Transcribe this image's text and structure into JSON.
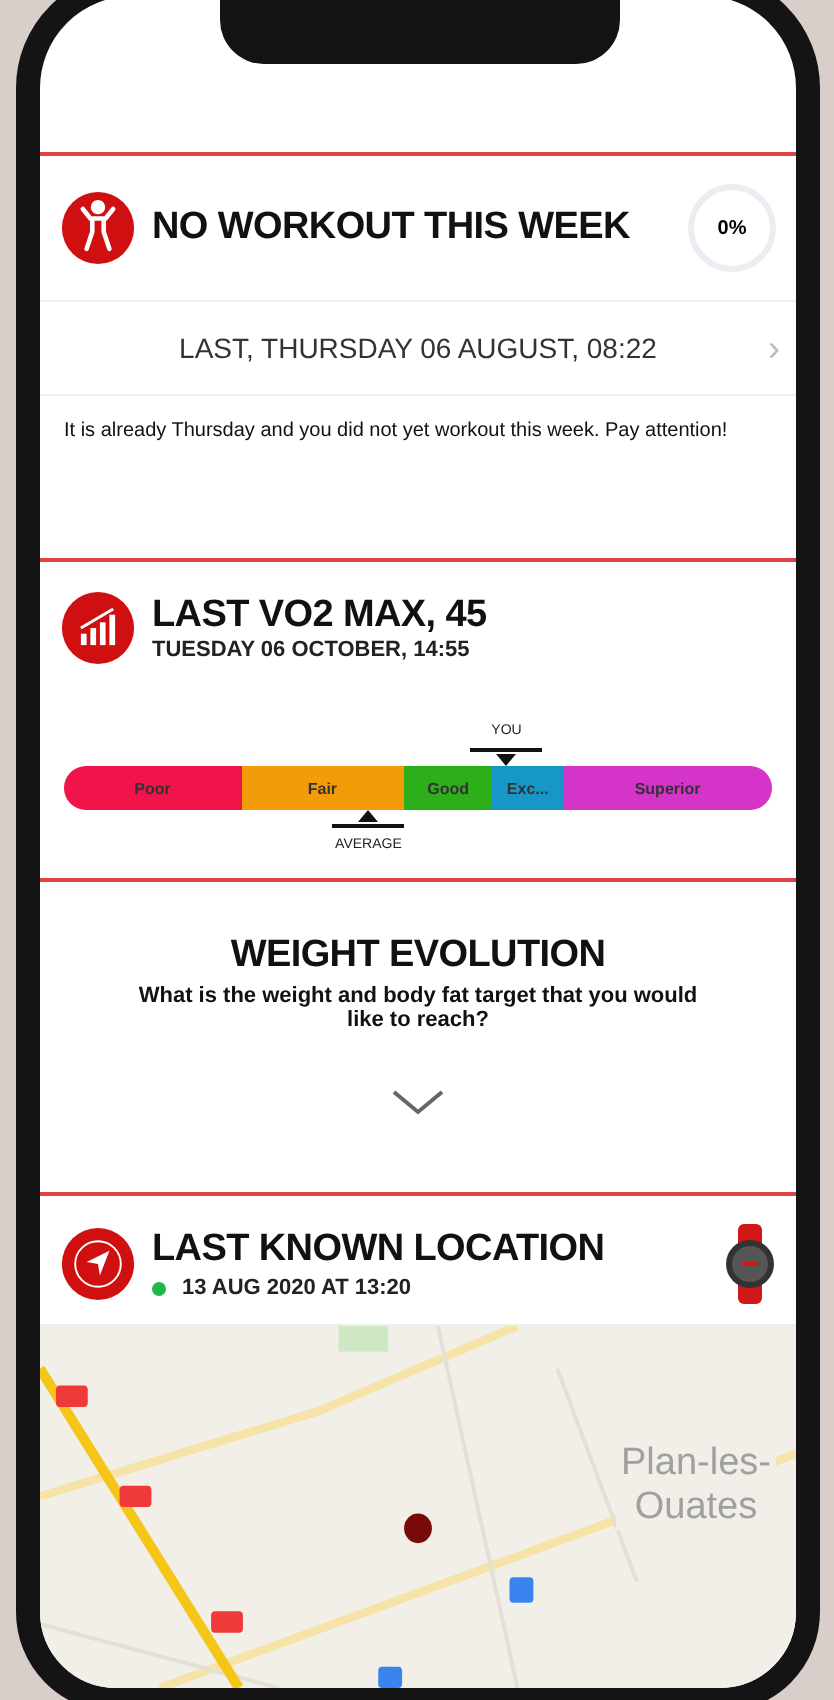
{
  "workout": {
    "title": "NO WORKOUT THIS WEEK",
    "ring_value": "0%",
    "last": "LAST, THURSDAY 06 AUGUST, 08:22",
    "chevron": "›",
    "message": "It is already Thursday and you did not yet workout this week. Pay attention!"
  },
  "vo2": {
    "title": "LAST VO2 MAX, 45",
    "subtitle": "TUESDAY 06 OCTOBER, 14:55",
    "segments": [
      {
        "label": "Poor",
        "color": "#f0144a"
      },
      {
        "label": "Fair",
        "color": "#f39c0a"
      },
      {
        "label": "Good",
        "color": "#2fae1c"
      },
      {
        "label": "Exc...",
        "color": "#1796c8"
      },
      {
        "label": "Superior",
        "color": "#d435c8"
      }
    ],
    "you": {
      "label": "YOU",
      "level": 0.625
    },
    "average": {
      "label": "AVERAGE",
      "level": 0.43
    }
  },
  "weight": {
    "title": "WEIGHT EVOLUTION",
    "question": "What is the weight and body fat target that you would like to reach?",
    "expanded": false
  },
  "location": {
    "title": "LAST KNOWN LOCATION",
    "date": "13 AUG 2020 AT 13:20",
    "map_label": "Plan-les-Ouates"
  }
}
